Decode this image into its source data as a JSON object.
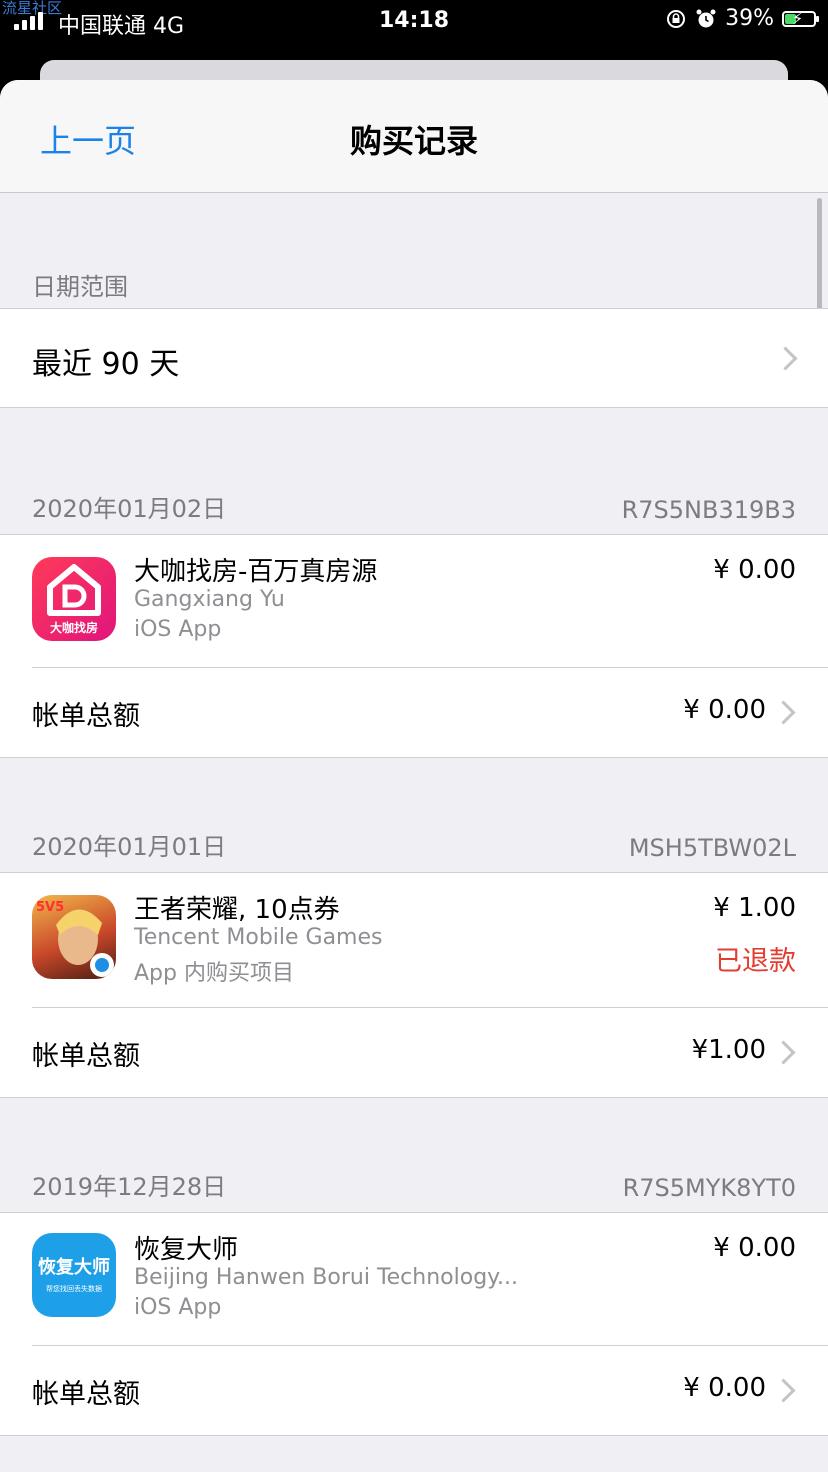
{
  "status_bar": {
    "watermark": "流星社区",
    "carrier": "中国联通  4G",
    "time": "14:18",
    "battery": "39%",
    "icons": [
      "signal-icon",
      "rotation-lock-icon",
      "alarm-icon",
      "battery-charging-icon"
    ]
  },
  "nav": {
    "back_label": "上一页",
    "title": "购买记录"
  },
  "date_range": {
    "header": "日期范围",
    "value": "最近 90 天"
  },
  "orders": [
    {
      "date": "2020年01月02日",
      "order_id": "R7S5NB319B3",
      "item": {
        "name": "大咖找房-百万真房源",
        "developer": "Gangxiang Yu",
        "type": "iOS App",
        "price": "¥ 0.00",
        "icon_text": "大咖找房",
        "icon": "dakazhaofang-app-icon"
      },
      "total_label": "帐单总额",
      "total": "¥ 0.00"
    },
    {
      "date": "2020年01月01日",
      "order_id": "MSH5TBW02L",
      "item": {
        "name": "王者荣耀, 10点券",
        "developer": "Tencent Mobile Games",
        "type": "App 内购买项目",
        "price": "¥ 1.00",
        "status": "已退款",
        "icon_text": "5V5",
        "icon": "honor-of-kings-app-icon"
      },
      "total_label": "帐单总额",
      "total": "¥1.00"
    },
    {
      "date": "2019年12月28日",
      "order_id": "R7S5MYK8YT0",
      "item": {
        "name": "恢复大师",
        "developer": "Beijing Hanwen Borui Technology...",
        "type": "iOS App",
        "price": "¥ 0.00",
        "icon_text": "恢复大师",
        "icon_subtext": "帮您找回丢失数据",
        "icon": "recovery-master-app-icon"
      },
      "total_label": "帐单总额",
      "total": "¥ 0.00"
    }
  ],
  "colors": {
    "link": "#1a83e8",
    "refund": "#e43d30",
    "background": "#efeff4"
  }
}
